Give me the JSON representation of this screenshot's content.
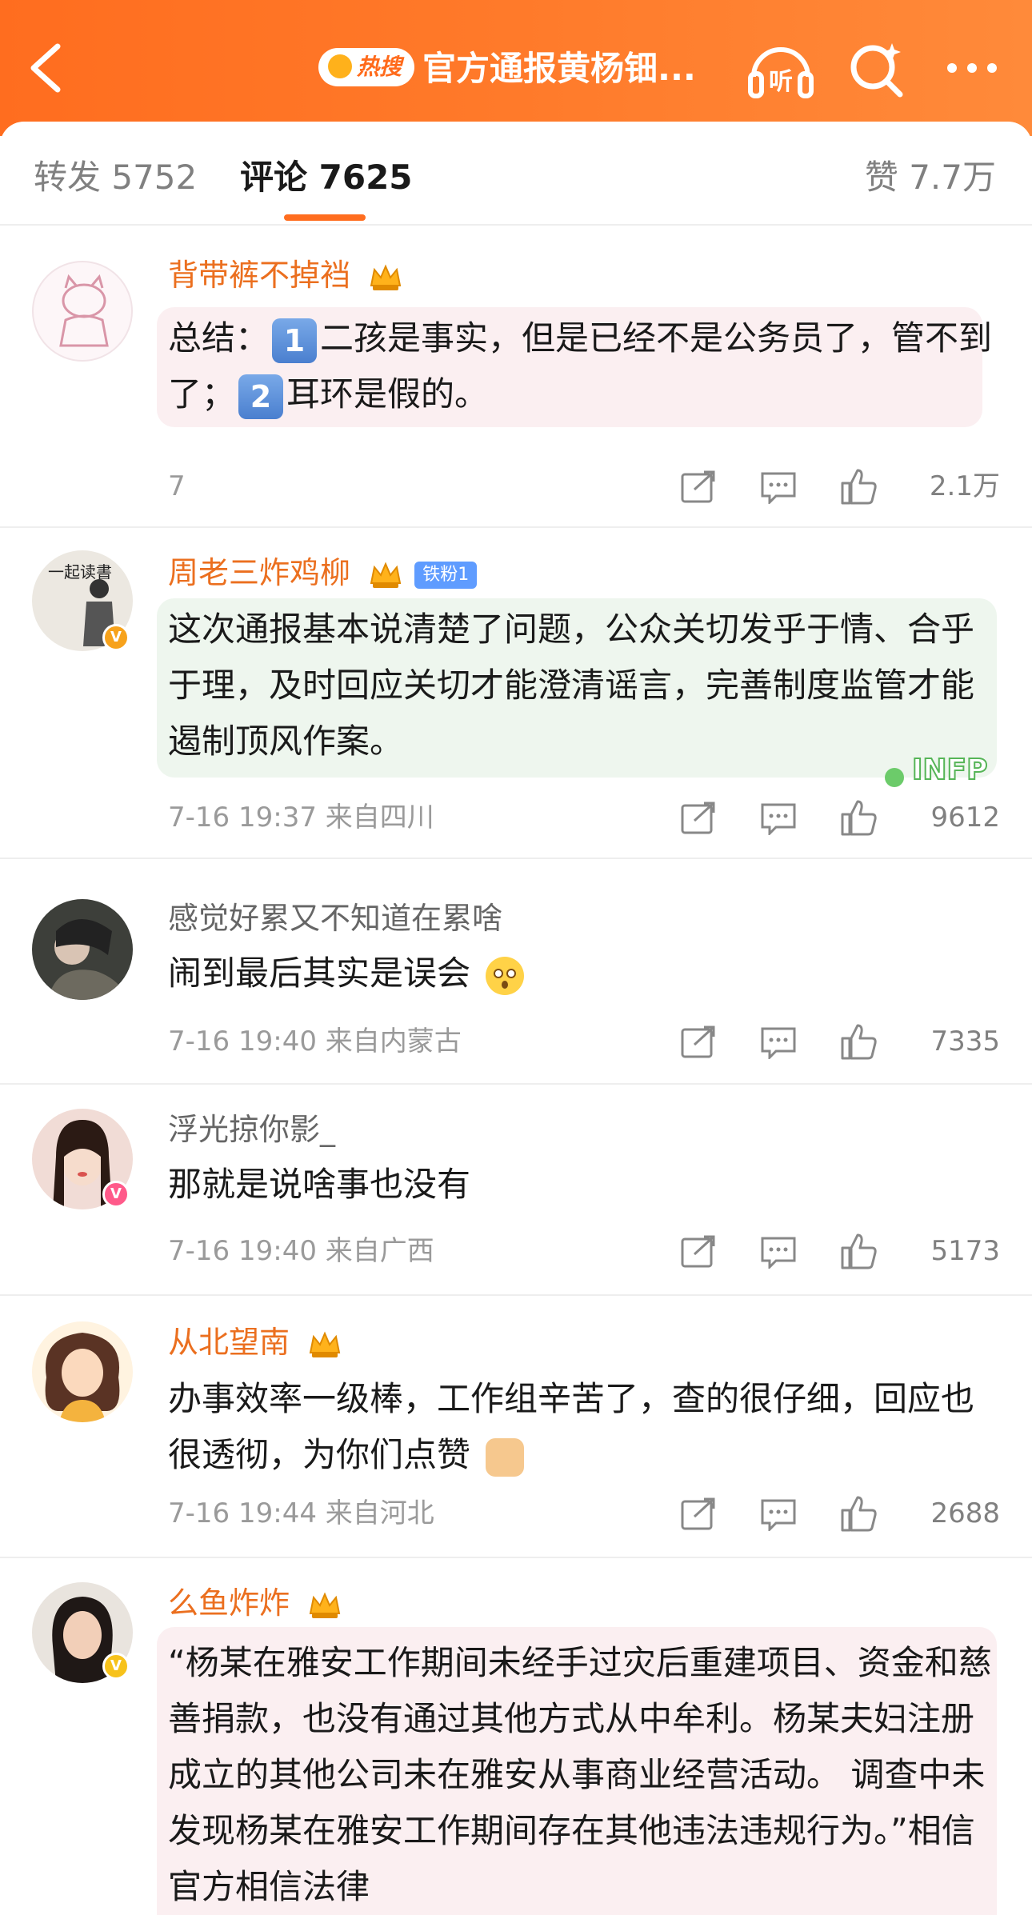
{
  "header": {
    "hot_label": "热搜",
    "title": "官方通报黄杨钿...",
    "listen_label": "听"
  },
  "tabs": {
    "repost": "转发 5752",
    "comment": "评论 7625",
    "like": "赞 7.7万"
  },
  "comments": [
    {
      "username": "背带裤不掉裆",
      "text_parts": [
        "总结：",
        "1",
        "二孩是事实，但是已经不是公务员了，管不到了；",
        "2",
        "耳环是假的。"
      ],
      "meta": "7",
      "likes": "2.1万"
    },
    {
      "username": "周老三炸鸡柳",
      "fan_badge": "铁粉1",
      "text": "这次通报基本说清楚了问题，公众关切发乎于情、合乎于理，及时回应关切才能澄清谣言，完善制度监管才能遏制顶风作案。",
      "avatar_text": "一起读書",
      "sticker": "INFP",
      "meta": "7-16 19:37  来自四川",
      "likes": "9612"
    },
    {
      "username": "感觉好累又不知道在累啥",
      "text": "闹到最后其实是误会",
      "meta": "7-16 19:40  来自内蒙古",
      "likes": "7335"
    },
    {
      "username": "浮光掠你影_",
      "text": "那就是说啥事也没有",
      "meta": "7-16 19:40  来自广西",
      "likes": "5173"
    },
    {
      "username": "从北望南",
      "text": "办事效率一级棒，工作组辛苦了，查的很仔细，回应也很透彻，为你们点赞",
      "meta": "7-16 19:44  来自河北",
      "likes": "2688"
    },
    {
      "username": "么鱼炸炸",
      "text": "“杨某在雅安工作期间未经手过灾后重建项目、资金和慈善捐款，也没有通过其他方式从中牟利。杨某夫妇注册成立的其他公司未在雅安从事商业经营活动。 调查中未发现杨某在雅安工作期间存在其他违法违规行为。”相信官方相信法律"
    }
  ],
  "colors": {
    "accent": "#ff6d1f",
    "username_orange": "#eb6f1f",
    "bubble_pink": "#fbeff1",
    "bubble_green": "#eef6ee"
  },
  "icons": [
    "back-icon",
    "hot-search-icon",
    "listen-icon",
    "search-icon",
    "more-icon",
    "share-icon",
    "comment-icon",
    "like-icon",
    "crown-icon",
    "verified-icon"
  ]
}
